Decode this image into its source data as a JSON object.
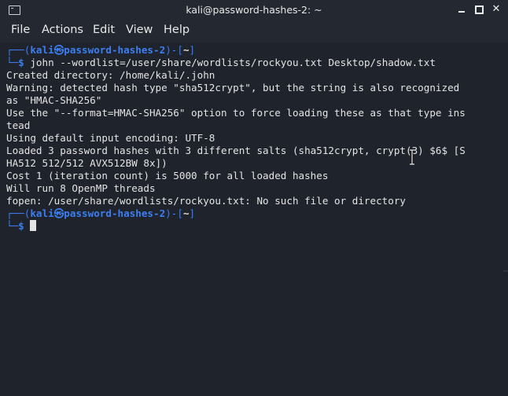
{
  "window": {
    "title": "kali@password-hashes-2: ~",
    "icon": "terminal-icon",
    "controls": [
      "minimize",
      "maximize",
      "close"
    ]
  },
  "menu": {
    "file": "File",
    "actions": "Actions",
    "edit": "Edit",
    "view": "View",
    "help": "Help"
  },
  "terminal": {
    "prompt1": {
      "top": "┌──(",
      "user": "kali",
      "at": "㉿",
      "host": "password-hashes-2",
      "mid": ")-[",
      "dir": "~",
      "end": "]",
      "dollar_prefix": "└─",
      "dollar": "$",
      "command": " john --wordlist=/user/share/wordlists/rockyou.txt Desktop/shadow.txt"
    },
    "output": [
      "Created directory: /home/kali/.john",
      "Warning: detected hash type \"sha512crypt\", but the string is also recognized",
      "as \"HMAC-SHA256\"",
      "Use the \"--format=HMAC-SHA256\" option to force loading these as that type ins",
      "tead",
      "Using default input encoding: UTF-8",
      "Loaded 3 password hashes with 3 different salts (sha512crypt, crypt(3) $6$ [S",
      "HA512 512/512 AVX512BW 8x])",
      "Cost 1 (iteration count) is 5000 for all loaded hashes",
      "Will run 8 OpenMP threads",
      "fopen: /user/share/wordlists/rockyou.txt: No such file or directory"
    ],
    "prompt2": {
      "top": "┌──(",
      "user": "kali",
      "at": "㉿",
      "host": "password-hashes-2",
      "mid": ")-[",
      "dir": "~",
      "end": "]",
      "dollar_prefix": "└─",
      "dollar": "$"
    }
  },
  "colors": {
    "background": "#1f232b",
    "prompt_frame": "#3d7ef0",
    "prompt_user": "#3d7ef0",
    "text": "#e4e4e4"
  }
}
